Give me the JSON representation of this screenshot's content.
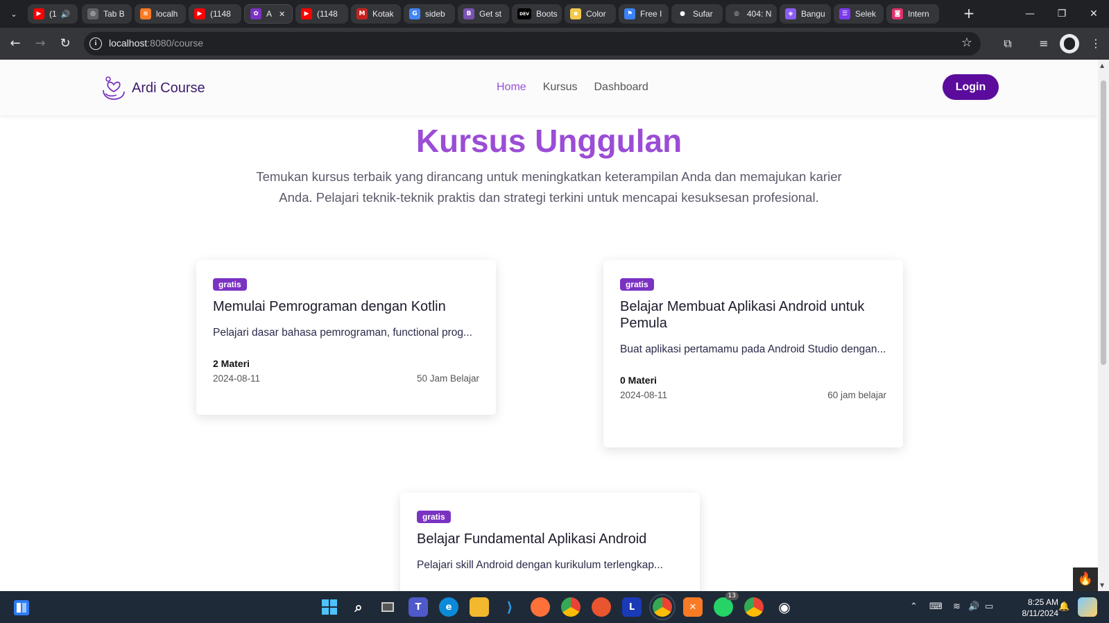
{
  "browser": {
    "tabs": [
      {
        "title": "(1",
        "icon": "youtube-icon",
        "color": "#ff0000",
        "glyph": "▶",
        "extra": "🔊"
      },
      {
        "title": "Tab B",
        "icon": "chrome-icon",
        "color": "#5f6368",
        "glyph": "◎"
      },
      {
        "title": "localh",
        "icon": "xampp-icon",
        "color": "#fb7a24",
        "glyph": "≋"
      },
      {
        "title": "(1148",
        "icon": "youtube-icon",
        "color": "#ff0000",
        "glyph": "▶"
      },
      {
        "title": "A",
        "icon": "ardi-course-icon",
        "color": "#7a32c2",
        "glyph": "✿",
        "active": true
      },
      {
        "title": "(1148",
        "icon": "youtube-icon",
        "color": "#ff0000",
        "glyph": "▶"
      },
      {
        "title": "Kotak",
        "icon": "gmail-icon",
        "color": "#c5221f",
        "glyph": "M"
      },
      {
        "title": "sideb",
        "icon": "google-icon",
        "color": "#4285f4",
        "glyph": "G"
      },
      {
        "title": "Get st",
        "icon": "bootstrap-icon",
        "color": "#7952b3",
        "glyph": "B"
      },
      {
        "title": "Boots",
        "icon": "dev-icon",
        "color": "#000000",
        "glyph": "DEV"
      },
      {
        "title": "Color",
        "icon": "color-icon",
        "color": "#f2c94c",
        "glyph": "▪"
      },
      {
        "title": "Free I",
        "icon": "flag-icon",
        "color": "#3b82f6",
        "glyph": "⚑"
      },
      {
        "title": "Sufar",
        "icon": "github-icon",
        "color": "#ffffff",
        "glyph": "●"
      },
      {
        "title": "404: N",
        "icon": "globe-icon",
        "color": "#9aa0a6",
        "glyph": "◍"
      },
      {
        "title": "Bangu",
        "icon": "cube-icon",
        "color": "#8b5cf6",
        "glyph": "◈"
      },
      {
        "title": "Selek",
        "icon": "list-icon",
        "color": "#7c3aed",
        "glyph": "☰"
      },
      {
        "title": "Intern",
        "icon": "instagram-icon",
        "color": "#e1306c",
        "glyph": "◙"
      }
    ],
    "close_tab": "✕",
    "new_tab": "+",
    "url_host": "localhost",
    "url_path": ":8080/course",
    "window_min": "—",
    "window_restore": "❐",
    "window_close": "✕"
  },
  "site": {
    "brand_name": "Ardi Course",
    "menu": [
      {
        "label": "Home",
        "active": true
      },
      {
        "label": "Kursus",
        "active": false
      },
      {
        "label": "Dashboard",
        "active": false
      }
    ],
    "login_label": "Login",
    "hero_title": "Kursus Unggulan",
    "hero_subtitle": "Temukan kursus terbaik yang dirancang untuk meningkatkan keterampilan Anda dan memajukan karier Anda. Pelajari teknik-teknik praktis dan strategi terkini untuk mencapai kesuksesan profesional.",
    "accent_color": "#9b4dd6",
    "button_color": "#5b0c9c"
  },
  "courses": [
    {
      "badge": "gratis",
      "title": "Memulai Pemrograman dengan Kotlin",
      "description": "Pelajari dasar bahasa pemrograman, functional prog...",
      "materi": "2 Materi",
      "date": "2024-08-11",
      "duration": "50 Jam Belajar"
    },
    {
      "badge": "gratis",
      "title": "Belajar Membuat Aplikasi Android untuk Pemula",
      "description": "Buat aplikasi pertamamu pada Android Studio dengan...",
      "materi": "0 Materi",
      "date": "2024-08-11",
      "duration": "60 jam belajar"
    },
    {
      "badge": "gratis",
      "title": "Belajar Fundamental Aplikasi Android",
      "description": "Pelajari skill Android dengan kurikulum terlengkap...",
      "materi": "",
      "date": "",
      "duration": ""
    }
  ],
  "taskbar": {
    "time": "8:25 AM",
    "date": "8/11/2024",
    "whatsapp_badge": "13",
    "apps": [
      {
        "name": "windows-start-icon"
      },
      {
        "name": "search-icon"
      },
      {
        "name": "task-view-icon"
      },
      {
        "name": "teams-icon"
      },
      {
        "name": "edge-icon"
      },
      {
        "name": "file-explorer-icon"
      },
      {
        "name": "vscode-icon"
      },
      {
        "name": "firefox-icon"
      },
      {
        "name": "chrome-icon"
      },
      {
        "name": "brave-icon"
      },
      {
        "name": "l-app-icon"
      },
      {
        "name": "chrome-profile-icon"
      },
      {
        "name": "xampp-icon"
      },
      {
        "name": "whatsapp-icon"
      },
      {
        "name": "chrome-profile-2-icon"
      },
      {
        "name": "onion-icon"
      }
    ]
  }
}
